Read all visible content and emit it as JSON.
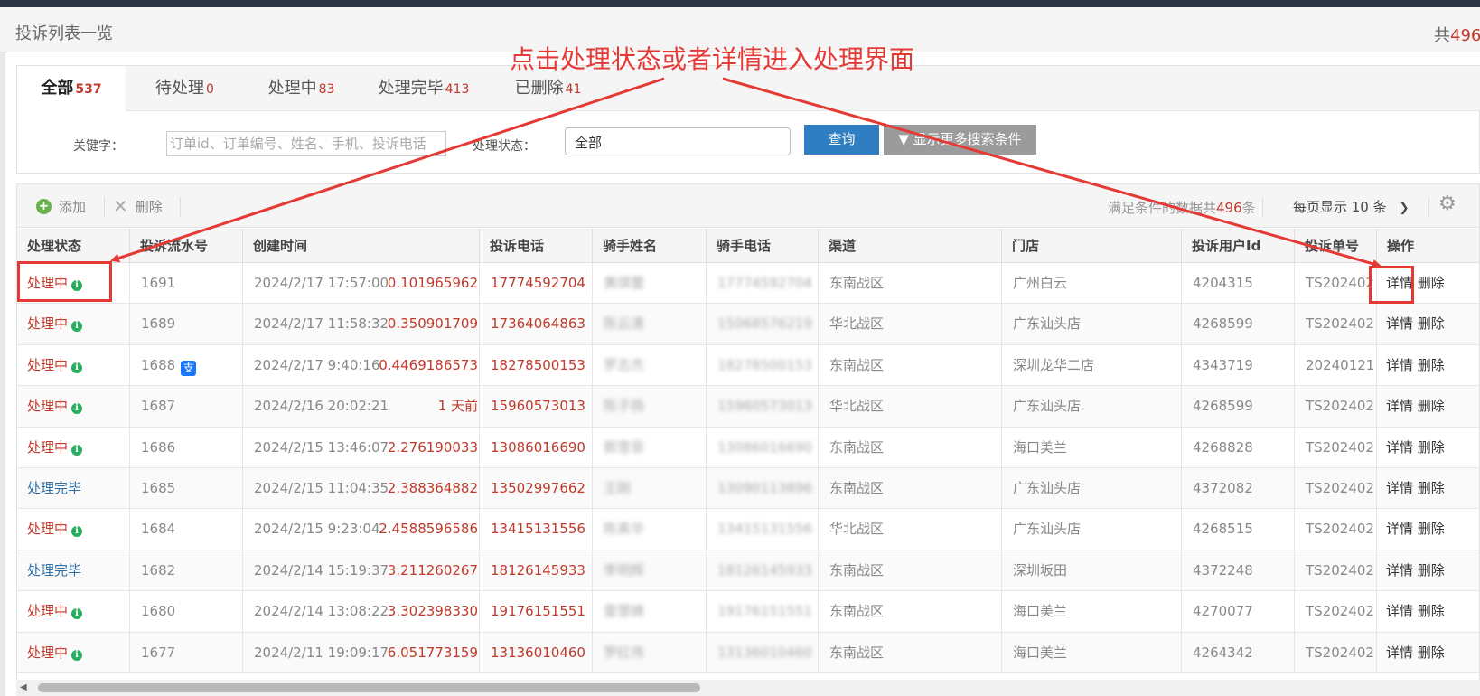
{
  "page": {
    "title": "投诉列表一览",
    "total_prefix": "共",
    "total_value": "496"
  },
  "annotation": {
    "text": "点击处理状态或者详情进入处理界面",
    "color": "#e53935"
  },
  "tabs": [
    {
      "label": "全部",
      "count": "537",
      "active": true
    },
    {
      "label": "待处理",
      "count": "0"
    },
    {
      "label": "处理中",
      "count": "83"
    },
    {
      "label": "处理完毕",
      "count": "413"
    },
    {
      "label": "已删除",
      "count": "41"
    }
  ],
  "search": {
    "keyword_label": "关键字：",
    "keyword_placeholder": "订单id、订单编号、姓名、手机、投诉电话",
    "status_label": "处理状态：",
    "status_value": "全部",
    "query_button": "查询",
    "more_button": "▼ 显示更多搜索条件"
  },
  "toolbar": {
    "add_label": "添加",
    "delete_label": "删除",
    "count_prefix": "满足条件的数据共",
    "count_value": "496",
    "count_suffix": "条",
    "per_page": "每页显示 10 条"
  },
  "columns": [
    "处理状态",
    "投诉流水号",
    "创建时间",
    "投诉电话",
    "骑手姓名",
    "骑手电话",
    "渠道",
    "门店",
    "投诉用户Id",
    "投诉单号",
    "操作"
  ],
  "actions": {
    "detail": "详情",
    "delete": "删除"
  },
  "rows": [
    {
      "status": "处理中",
      "status_type": "processing",
      "serial": "1691",
      "created": "2024/2/17 17:57:00",
      "elapsed": "0.101965962",
      "phone": "17774592704",
      "rider_name": "黄琪蕾",
      "rider_phone": "17774592704",
      "channel": "东南战区",
      "store": "广州白云",
      "user_id": "4204315",
      "order_no": "TS202402"
    },
    {
      "status": "处理中",
      "status_type": "processing",
      "serial": "1689",
      "created": "2024/2/17 11:58:32",
      "elapsed": "0.350901709",
      "phone": "17364064863",
      "rider_name": "陈云清",
      "rider_phone": "15068576219",
      "channel": "华北战区",
      "store": "广东汕头店",
      "user_id": "4268599",
      "order_no": "TS202402"
    },
    {
      "status": "处理中",
      "status_type": "processing",
      "serial": "1688",
      "pay_icon": true,
      "created": "2024/2/17 9:40:16",
      "elapsed": "0.4469186573",
      "phone": "18278500153",
      "rider_name": "罗志杰",
      "rider_phone": "18278500153",
      "channel": "东南战区",
      "store": "深圳龙华二店",
      "user_id": "4343719",
      "order_no": "20240121"
    },
    {
      "status": "处理中",
      "status_type": "processing",
      "serial": "1687",
      "created": "2024/2/16 20:02:21",
      "elapsed": "1 天前",
      "phone": "15960573013",
      "rider_name": "陈子扬",
      "rider_phone": "15960573013",
      "channel": "华北战区",
      "store": "广东汕头店",
      "user_id": "4268599",
      "order_no": "TS202402"
    },
    {
      "status": "处理中",
      "status_type": "processing",
      "serial": "1686",
      "created": "2024/2/15 13:46:07",
      "elapsed": "2.276190033",
      "phone": "13086016690",
      "rider_name": "郭雪菲",
      "rider_phone": "13086016690",
      "channel": "东南战区",
      "store": "海口美兰",
      "user_id": "4268828",
      "order_no": "TS202402"
    },
    {
      "status": "处理完毕",
      "status_type": "done",
      "serial": "1685",
      "created": "2024/2/15 11:04:35",
      "elapsed": "2.388364882",
      "phone": "13502997662",
      "rider_name": "王刚",
      "rider_phone": "13090113896",
      "channel": "东南战区",
      "store": "广东汕头店",
      "user_id": "4372082",
      "order_no": "TS202402"
    },
    {
      "status": "处理中",
      "status_type": "processing",
      "serial": "1684",
      "created": "2024/2/15 9:23:04",
      "elapsed": "2.4588596586",
      "phone": "13415131556",
      "rider_name": "陈英华",
      "rider_phone": "13415131556",
      "channel": "华北战区",
      "store": "广东汕头店",
      "user_id": "4268515",
      "order_no": "TS202402"
    },
    {
      "status": "处理完毕",
      "status_type": "done",
      "serial": "1682",
      "created": "2024/2/14 15:19:37",
      "elapsed": "3.211260267",
      "phone": "18126145933",
      "rider_name": "李明辉",
      "rider_phone": "18126145933",
      "channel": "东南战区",
      "store": "深圳坂田",
      "user_id": "4372248",
      "order_no": "TS202402"
    },
    {
      "status": "处理中",
      "status_type": "processing",
      "serial": "1680",
      "created": "2024/2/14 13:08:22",
      "elapsed": "3.302398330",
      "phone": "19176151551",
      "rider_name": "雷慧婧",
      "rider_phone": "19176151551",
      "channel": "东南战区",
      "store": "海口美兰",
      "user_id": "4270077",
      "order_no": "TS202402"
    },
    {
      "status": "处理中",
      "status_type": "processing",
      "serial": "1677",
      "created": "2024/2/11 19:09:17",
      "elapsed": "6.051773159",
      "phone": "13136010460",
      "rider_name": "罗红伟",
      "rider_phone": "13136010460",
      "channel": "东南战区",
      "store": "海口美兰",
      "user_id": "4264342",
      "order_no": "TS202402"
    }
  ]
}
